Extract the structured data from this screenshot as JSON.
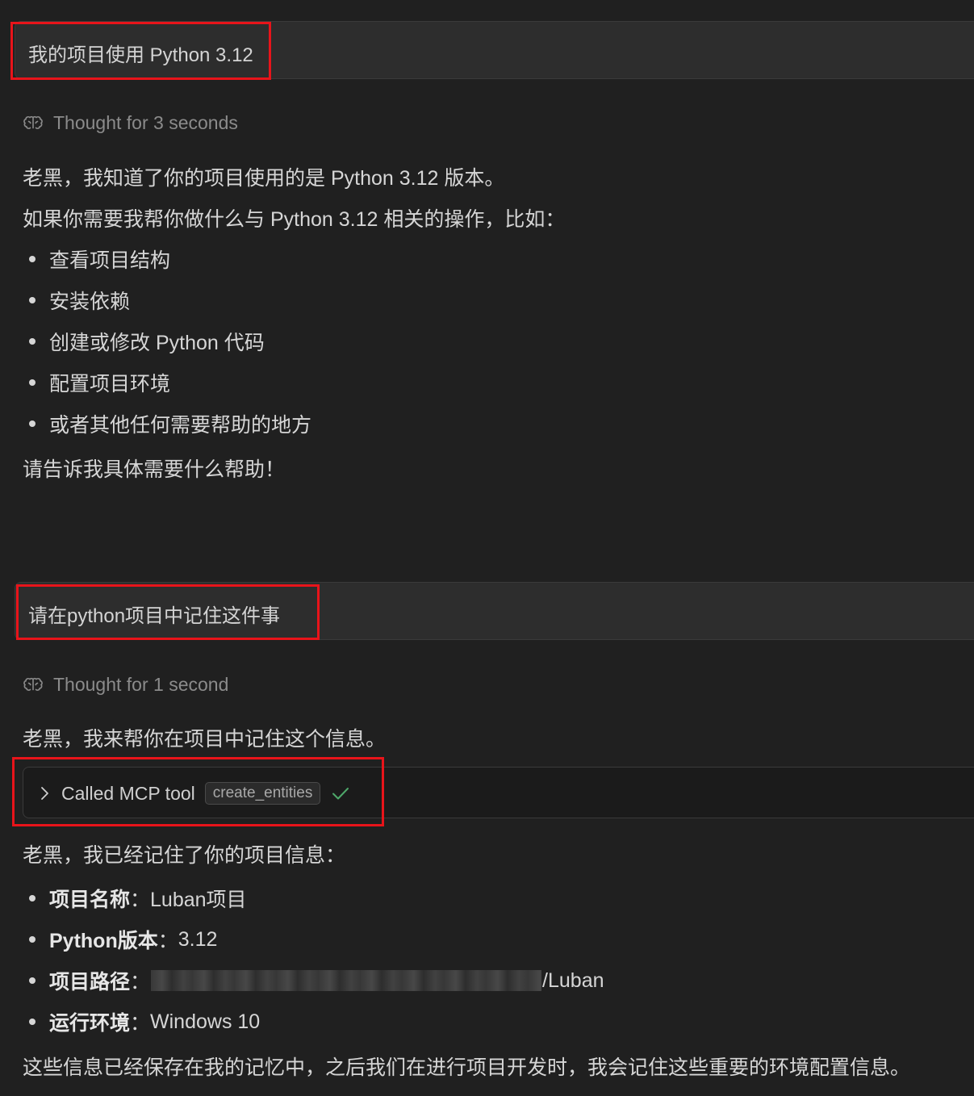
{
  "messages": [
    {
      "user_text": "我的项目使用 Python 3.12",
      "thought": "Thought for 3 seconds",
      "reply_intro": "老黑，我知道了你的项目使用的是 Python 3.12 版本。",
      "reply_lead": "如果你需要我帮你做什么与 Python 3.12 相关的操作，比如：",
      "reply_items": [
        "查看项目结构",
        "安装依赖",
        "创建或修改 Python 代码",
        "配置项目环境",
        "或者其他任何需要帮助的地方"
      ],
      "reply_outro": "请告诉我具体需要什么帮助！"
    },
    {
      "user_text": "请在python项目中记住这件事",
      "thought": "Thought for 1 second",
      "reply_intro": "老黑，我来帮你在项目中记住这个信息。",
      "tool_call": {
        "label": "Called MCP tool",
        "tool_name": "create_entities",
        "status_icon": "check-icon",
        "status_color": "#4ea86a"
      },
      "reply_lead": "老黑，我已经记住了你的项目信息：",
      "facts": [
        {
          "key": "项目名称",
          "sep": "：",
          "value": "Luban项目"
        },
        {
          "key": "Python版本",
          "sep": "：",
          "value": "3.12"
        },
        {
          "key": "项目路径",
          "sep": "：",
          "value": "/Luban"
        },
        {
          "key": "运行环境",
          "sep": "：",
          "value": "Windows 10"
        }
      ],
      "reply_outro": "这些信息已经保存在我的记忆中，之后我们在进行项目开发时，我会记住这些重要的环境配置信息。"
    }
  ],
  "colors": {
    "background": "#202020",
    "highlight_box": "#e8141a",
    "muted_text": "#8b8b8b"
  }
}
